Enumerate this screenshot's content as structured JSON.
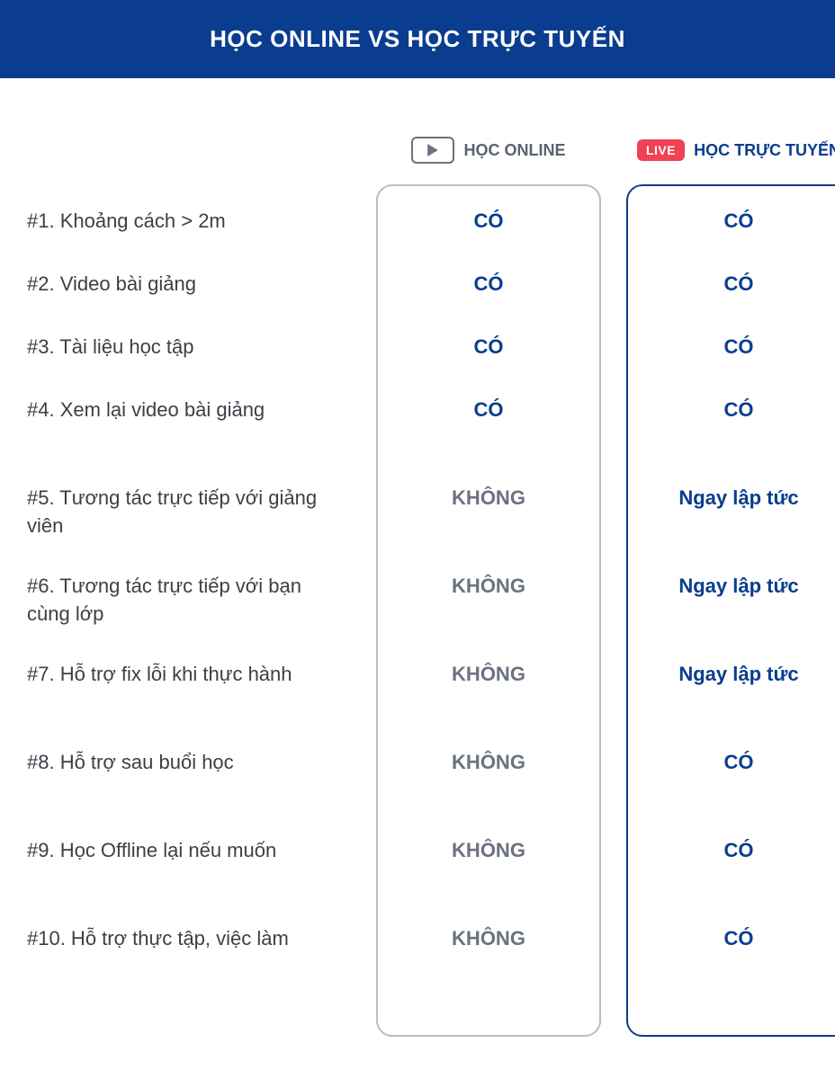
{
  "header": {
    "title": "HỌC ONLINE VS HỌC TRỰC TUYẾN"
  },
  "columns": {
    "online": {
      "badge": "play",
      "label": "HỌC ONLINE"
    },
    "live": {
      "badge": "LIVE",
      "label": "HỌC TRỰC TUYẾN"
    }
  },
  "rows": [
    {
      "label": "#1. Khoảng cách > 2m",
      "online": "CÓ",
      "live": "CÓ",
      "short": true
    },
    {
      "label": "#2. Video bài giảng",
      "online": "CÓ",
      "live": "CÓ",
      "short": true
    },
    {
      "label": "#3. Tài liệu học tập",
      "online": "CÓ",
      "live": "CÓ",
      "short": true
    },
    {
      "label": "#4. Xem lại video bài giảng",
      "online": "CÓ",
      "live": "CÓ",
      "short": false
    },
    {
      "label": "#5. Tương tác trực tiếp với giảng viên",
      "online": "KHÔNG",
      "live": "Ngay lập tức",
      "short": false
    },
    {
      "label": "#6. Tương tác trực tiếp với bạn cùng lớp",
      "online": "KHÔNG",
      "live": "Ngay lập tức",
      "short": false
    },
    {
      "label": "#7. Hỗ trợ fix lỗi khi thực hành",
      "online": "KHÔNG",
      "live": "Ngay lập tức",
      "short": false
    },
    {
      "label": "#8. Hỗ trợ sau buổi học",
      "online": "KHÔNG",
      "live": "CÓ",
      "short": false
    },
    {
      "label": "#9. Học Offline lại nếu muốn",
      "online": "KHÔNG",
      "live": "CÓ",
      "short": false
    },
    {
      "label": "#10. Hỗ trợ thực tập, việc làm",
      "online": "KHÔNG",
      "live": "CÓ",
      "short": false
    }
  ]
}
